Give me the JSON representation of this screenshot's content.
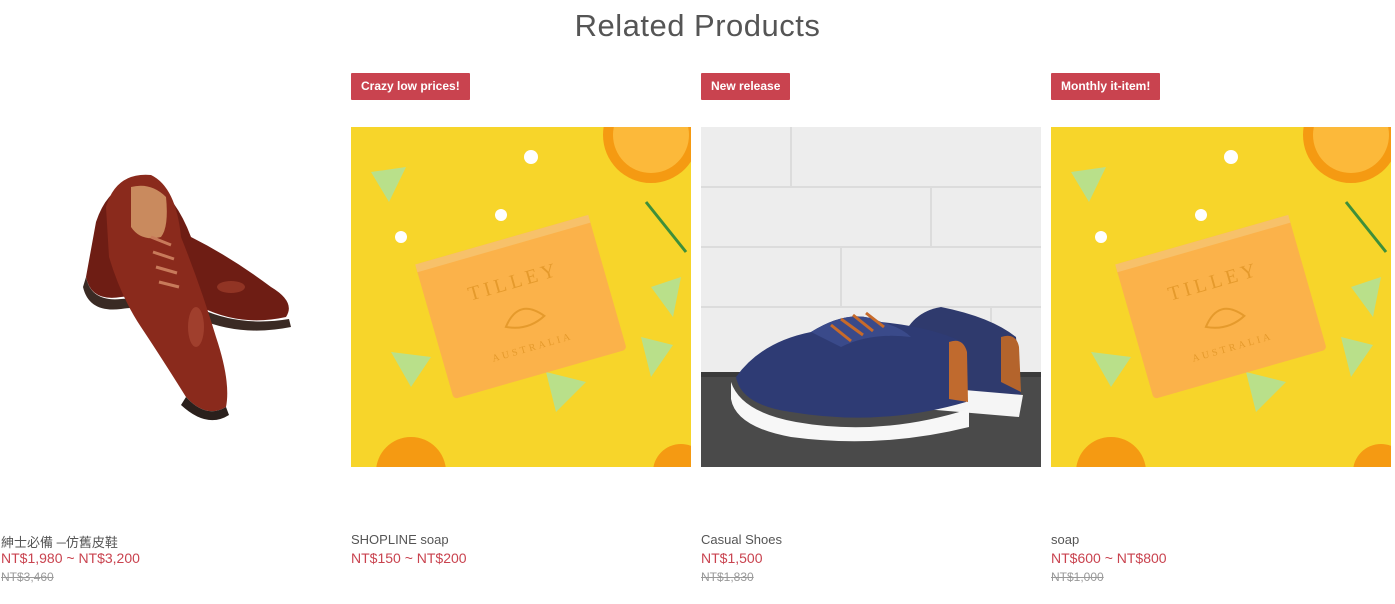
{
  "section": {
    "title": "Related Products"
  },
  "products": [
    {
      "name": "紳士必備 ─仿舊皮鞋",
      "price": "NT$1,980 ~ NT$3,200",
      "original_price": "NT$3,460",
      "image": "leather-shoes"
    },
    {
      "badge": "Crazy low prices!",
      "name": "SHOPLINE soap",
      "price": "NT$150 ~ NT$200",
      "image": "soap-bar",
      "image_text": [
        "TILLEY",
        "AUSTRALIA"
      ]
    },
    {
      "badge": "New release",
      "name": "Casual Shoes",
      "price": "NT$1,500",
      "original_price": "NT$1,830",
      "image": "canvas-sneakers"
    },
    {
      "badge": "Monthly it-item!",
      "name": "soap",
      "price": "NT$600 ~ NT$800",
      "original_price": "NT$1,000",
      "image": "soap-bar",
      "image_text": [
        "TILLEY",
        "AUSTRALIA"
      ]
    }
  ],
  "colors": {
    "accent": "#c9434f",
    "title": "#555555",
    "soap_background": "#f7d52a"
  }
}
